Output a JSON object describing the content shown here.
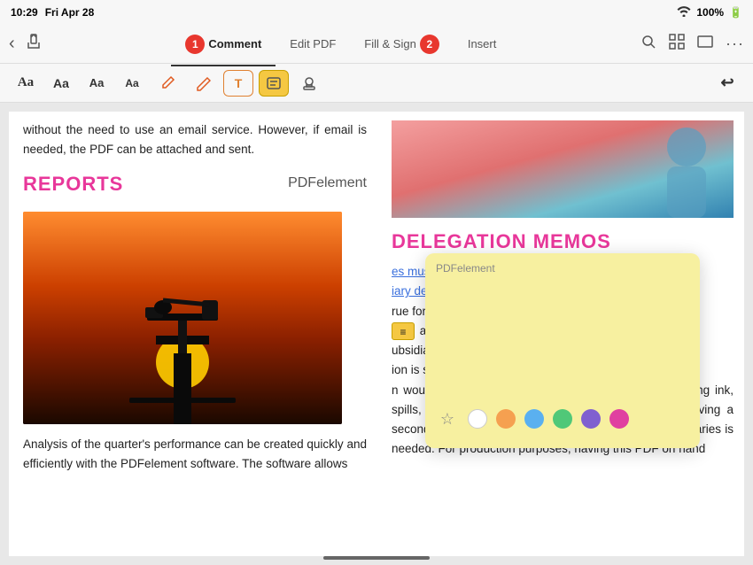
{
  "status_bar": {
    "time": "10:29",
    "day": "Fri Apr 28",
    "battery": "100%",
    "battery_icon": "🔋",
    "wifi_icon": "wifi",
    "more_icon": "···"
  },
  "top_nav": {
    "back_icon": "‹",
    "share_icon": "↑",
    "tabs": [
      {
        "id": "comment",
        "label": "Comment",
        "active": true,
        "badge": "1"
      },
      {
        "id": "edit-pdf",
        "label": "Edit PDF",
        "active": false
      },
      {
        "id": "fill-sign",
        "label": "Fill & Sign",
        "active": false,
        "badge": "2"
      },
      {
        "id": "insert",
        "label": "Insert",
        "active": false
      }
    ],
    "search_icon": "🔍",
    "grid_icon": "⊞",
    "rect_icon": "▭",
    "more_icon": "···"
  },
  "toolbar": {
    "tools": [
      {
        "id": "text-aa-serif",
        "label": "Aa",
        "style": "serif",
        "active": false
      },
      {
        "id": "text-aa-normal",
        "label": "Aa",
        "style": "normal",
        "active": false
      },
      {
        "id": "text-aa-small",
        "label": "Aa",
        "style": "small",
        "active": false
      },
      {
        "id": "text-aa-tiny",
        "label": "Aa",
        "style": "tiny",
        "active": false
      },
      {
        "id": "pencil-tool",
        "label": "✏",
        "active": false
      },
      {
        "id": "eraser-tool",
        "label": "⌀",
        "active": false
      },
      {
        "id": "highlight-tool",
        "label": "T",
        "active": false
      },
      {
        "id": "sticky-note-tool",
        "label": "≡",
        "active": true
      },
      {
        "id": "stamp-tool",
        "label": "◎",
        "active": false
      }
    ],
    "undo_icon": "↩"
  },
  "pdf_content": {
    "left": {
      "intro_text": "without the need to use an email service. However, if email is needed, the PDF can be attached and sent.",
      "reports_title": "REPORTS",
      "pdfelement_label": "PDFelement",
      "analysis_text": "Analysis of the quarter's performance can be created quickly and efficiently with the PDFelement software. The software allows"
    },
    "right": {
      "delegation_title": "DELEGATION MEMOS",
      "body_text_1": "es must be able to delegate",
      "body_text_2": "iary dependencies clearly.",
      "body_text_3": "rue for the transport and",
      "body_text_4": "and regulations of",
      "body_text_5": "ubsidiary company. Since",
      "body_text_6": "ion is subject to a variety",
      "body_text_7": "n would compromise the integrity of the document (fading ink, spills, dirt, misaligned cartridges in the printer etc.) having a secondary form available in PDF format for those subsidiaries is needed. For production purposes, having this PDF on hand"
    }
  },
  "sticky_note": {
    "author": "PDFelement",
    "content": "",
    "colors": [
      {
        "id": "white",
        "hex": "#ffffff"
      },
      {
        "id": "orange",
        "hex": "#f5a050"
      },
      {
        "id": "blue",
        "hex": "#5ab0f0"
      },
      {
        "id": "green",
        "hex": "#50c878"
      },
      {
        "id": "purple",
        "hex": "#8060d0"
      },
      {
        "id": "pink",
        "hex": "#e040a0"
      }
    ],
    "icon_label": "⊙"
  }
}
